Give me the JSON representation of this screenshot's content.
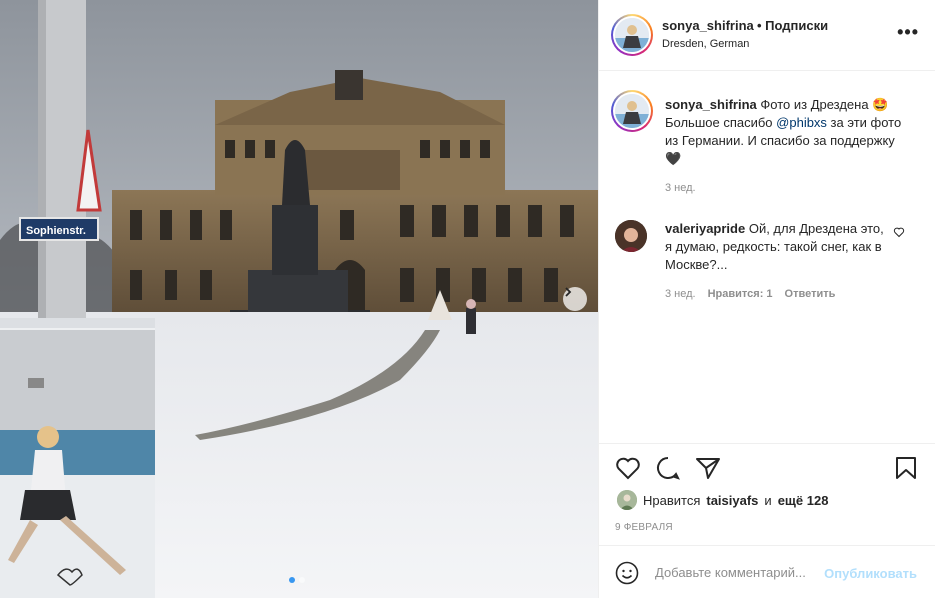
{
  "post": {
    "username": "sonya_shifrina",
    "follow_label": "• Подписки",
    "location": "Dresden, German",
    "more_label": "•••"
  },
  "photo": {
    "street_sign": "Sophienstr."
  },
  "caption": {
    "username": "sonya_shifrina",
    "text_before": " Фото из Дрездена 🤩 Большое спасибо ",
    "mention": "@phibxs",
    "text_after": " за эти фото из Германии. И спасибо за поддержку 🖤",
    "time": "3 нед."
  },
  "comment": {
    "username": "valeriyapride",
    "text": " Ой, для Дрездена это, я думаю, редкость: такой снег, как в Москве?...",
    "time": "3 нед.",
    "likes": "Нравится: 1",
    "reply": "Ответить"
  },
  "likes": {
    "prefix": "Нравится",
    "user": "taisiyafs",
    "middle": "и",
    "count": "ещё 128"
  },
  "date": "9 ФЕВРАЛЯ",
  "add_comment": {
    "placeholder": "Добавьте комментарий...",
    "publish": "Опубликовать"
  },
  "icons": {
    "more": "more-icon",
    "like": "heart-icon",
    "comment": "comment-icon",
    "share": "share-icon",
    "save": "bookmark-icon",
    "emoji": "emoji-icon",
    "next": "chevron-right-icon"
  },
  "colors": {
    "mention": "#00376b",
    "publish_disabled": "#b2dffc",
    "carousel_active": "#3897f0"
  }
}
